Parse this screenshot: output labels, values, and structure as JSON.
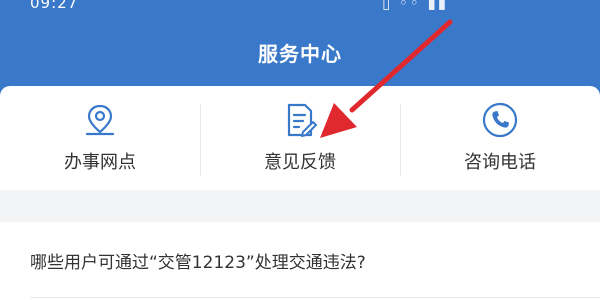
{
  "status_bar": {
    "time": "09:27",
    "icons_text": "▯ ◦◦ ▮▮"
  },
  "header": {
    "title": "服务中心"
  },
  "services": [
    {
      "label": "办事网点",
      "icon": "location-pin-icon"
    },
    {
      "label": "意见反馈",
      "icon": "feedback-edit-icon"
    },
    {
      "label": "咨询电话",
      "icon": "phone-icon"
    }
  ],
  "faq": {
    "question": "哪些用户可通过“交管12123”处理交通违法?"
  },
  "colors": {
    "header_bg": "#3a78c9",
    "icon_blue": "#3a78c9",
    "arrow_red": "#e0292e"
  }
}
